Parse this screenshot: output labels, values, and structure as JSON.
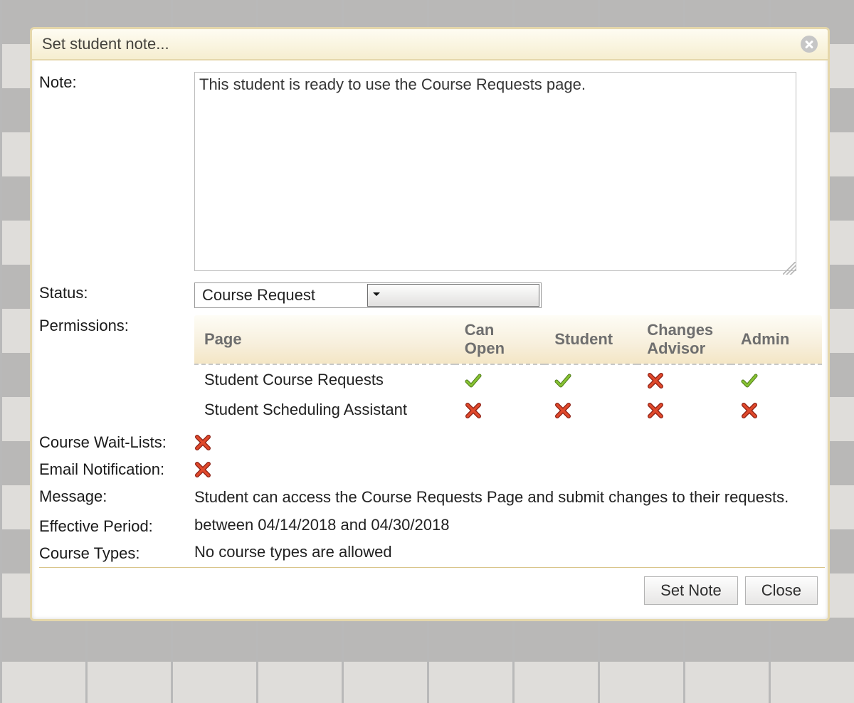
{
  "dialog": {
    "title": "Set student note..."
  },
  "labels": {
    "note": "Note:",
    "status": "Status:",
    "permissions": "Permissions:",
    "wait_lists": "Course Wait-Lists:",
    "email": "Email Notification:",
    "message": "Message:",
    "effective": "Effective Period:",
    "course_types": "Course Types:"
  },
  "note_value": "This student is ready to use the Course Requests page.",
  "status_selected": "Course Request",
  "perm_headers": {
    "page": "Page",
    "can_open": "Can Open",
    "student": "Student",
    "changes_advisor": "Changes Advisor",
    "admin": "Admin"
  },
  "perm_rows": [
    {
      "page": "Student Course Requests",
      "can_open": true,
      "student": true,
      "changes_advisor": false,
      "admin": true
    },
    {
      "page": "Student Scheduling Assistant",
      "can_open": false,
      "student": false,
      "changes_advisor": false,
      "admin": false
    }
  ],
  "wait_lists_enabled": false,
  "email_enabled": false,
  "message": "Student can access the Course Requests Page and submit changes to their requests.",
  "effective": "between 04/14/2018 and 04/30/2018",
  "course_types": "No course types are allowed",
  "buttons": {
    "set_note": "Set Note",
    "close": "Close"
  }
}
